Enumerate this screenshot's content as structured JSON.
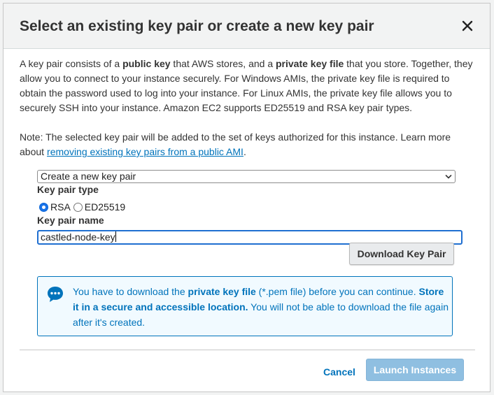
{
  "dialog": {
    "title": "Select an existing key pair or create a new key pair"
  },
  "description": {
    "t1": "A key pair consists of a ",
    "b1": "public key",
    "t2": " that AWS stores, and a ",
    "b2": "private key file",
    "t3": " that you store. Together, they allow you to connect to your instance securely. For Windows AMIs, the private key file is required to obtain the password used to log into your instance. For Linux AMIs, the private key file allows you to securely SSH into your instance. Amazon EC2 supports ED25519 and RSA key pair types."
  },
  "note": {
    "text": "Note: The selected key pair will be added to the set of keys authorized for this instance. Learn more about",
    "link": "removing existing key pairs from a public AMI",
    "period": "."
  },
  "keypair_select": {
    "selected": "Create a new key pair"
  },
  "key_type": {
    "label": "Key pair type",
    "options": [
      {
        "label": "RSA",
        "checked": true
      },
      {
        "label": "ED25519",
        "checked": false
      }
    ]
  },
  "key_name": {
    "label": "Key pair name",
    "value": "castled-node-key"
  },
  "buttons": {
    "download": "Download Key Pair",
    "cancel": "Cancel",
    "launch": "Launch Instances"
  },
  "info": {
    "t1": "You have to download the ",
    "b1": "private key file",
    "t2": " (*.pem file) before you can continue. ",
    "b2": "Store it in a secure and accessible location.",
    "t3": " You will not be able to download the file again after it's created."
  },
  "colors": {
    "accent": "#0073bb",
    "info_bg": "#f1faff",
    "launch_disabled": "#8fbfe1",
    "header_bg": "#f2f3f3"
  },
  "icons": {
    "close": "close-icon",
    "caret": "chevron-down-icon",
    "info": "speech-bubble-icon"
  }
}
